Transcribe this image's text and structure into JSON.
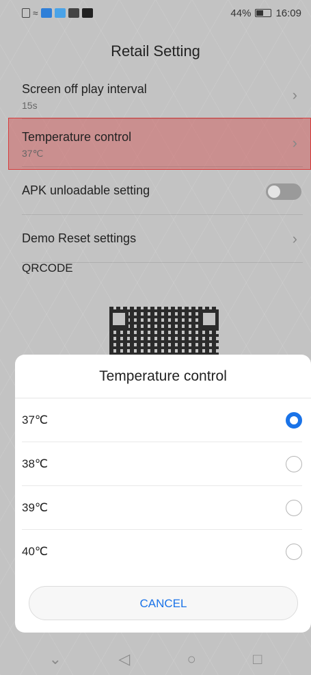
{
  "status": {
    "battery": "44%",
    "time": "16:09"
  },
  "header": {
    "title": "Retail Setting"
  },
  "settings": {
    "items": [
      {
        "label": "Screen off play interval",
        "value": "15s"
      },
      {
        "label": "Temperature control",
        "value": "37℃"
      },
      {
        "label": "APK unloadable setting"
      },
      {
        "label": "Demo Reset settings"
      }
    ],
    "apk_toggle_on": false,
    "qr_label": "QRCODE"
  },
  "dialog": {
    "title": "Temperature control",
    "options": [
      {
        "label": "37℃",
        "selected": true
      },
      {
        "label": "38℃",
        "selected": false
      },
      {
        "label": "39℃",
        "selected": false
      },
      {
        "label": "40℃",
        "selected": false
      }
    ],
    "cancel_label": "CANCEL"
  },
  "nav": {
    "icons": [
      "chevron-down-icon",
      "back-icon",
      "home-icon",
      "recents-icon"
    ]
  },
  "colors": {
    "accent": "#1a73e8",
    "highlight": "#d63b3b"
  }
}
